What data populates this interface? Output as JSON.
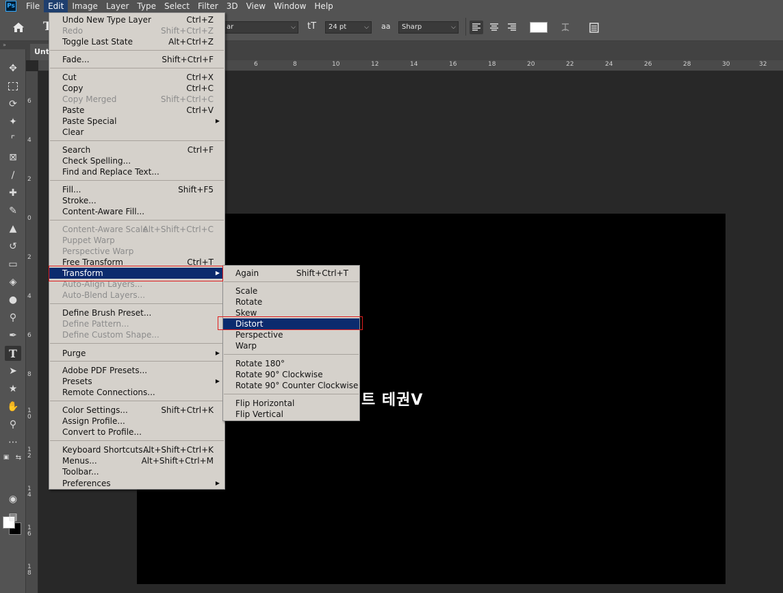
{
  "app": {
    "logo": "Ps"
  },
  "menubar": [
    "File",
    "Edit",
    "Image",
    "Layer",
    "Type",
    "Select",
    "Filter",
    "3D",
    "View",
    "Window",
    "Help"
  ],
  "options": {
    "type_tool_glyph": "T",
    "font_style": "ar",
    "size_icon": "tT",
    "font_size": "24 pt",
    "aa_icon": "aa",
    "antialias": "Sharp"
  },
  "document": {
    "tab_title": "Unti",
    "canvas_text": "트 테권V",
    "ruler_top_ticks": [
      "6",
      "8",
      "10",
      "12",
      "14",
      "16",
      "18",
      "20",
      "22",
      "24",
      "26",
      "28",
      "30",
      "32"
    ],
    "ruler_left_ticks": [
      "6",
      "4",
      "2",
      "0",
      "2",
      "4",
      "6",
      "8",
      "1 0",
      "1 2",
      "1 4",
      "1 6",
      "1 8"
    ]
  },
  "edit_menu": {
    "items": [
      {
        "label": "Undo New Type Layer",
        "shortcut": "Ctrl+Z"
      },
      {
        "label": "Redo",
        "shortcut": "Shift+Ctrl+Z",
        "disabled": true
      },
      {
        "label": "Toggle Last State",
        "shortcut": "Alt+Ctrl+Z"
      },
      {
        "label": "Fade...",
        "shortcut": "Shift+Ctrl+F"
      },
      {
        "label": "Cut",
        "shortcut": "Ctrl+X"
      },
      {
        "label": "Copy",
        "shortcut": "Ctrl+C"
      },
      {
        "label": "Copy Merged",
        "shortcut": "Shift+Ctrl+C",
        "disabled": true
      },
      {
        "label": "Paste",
        "shortcut": "Ctrl+V"
      },
      {
        "label": "Paste Special",
        "submenu": true
      },
      {
        "label": "Clear"
      },
      {
        "label": "Search",
        "shortcut": "Ctrl+F"
      },
      {
        "label": "Check Spelling..."
      },
      {
        "label": "Find and Replace Text..."
      },
      {
        "label": "Fill...",
        "shortcut": "Shift+F5"
      },
      {
        "label": "Stroke..."
      },
      {
        "label": "Content-Aware Fill..."
      },
      {
        "label": "Content-Aware Scale",
        "shortcut": "Alt+Shift+Ctrl+C",
        "disabled": true
      },
      {
        "label": "Puppet Warp",
        "disabled": true
      },
      {
        "label": "Perspective Warp",
        "disabled": true
      },
      {
        "label": "Free Transform",
        "shortcut": "Ctrl+T"
      },
      {
        "label": "Transform",
        "submenu": true,
        "highlighted": true
      },
      {
        "label": "Auto-Align Layers...",
        "disabled": true
      },
      {
        "label": "Auto-Blend Layers...",
        "disabled": true
      },
      {
        "label": "Define Brush Preset..."
      },
      {
        "label": "Define Pattern...",
        "disabled": true
      },
      {
        "label": "Define Custom Shape...",
        "disabled": true
      },
      {
        "label": "Purge",
        "submenu": true
      },
      {
        "label": "Adobe PDF Presets..."
      },
      {
        "label": "Presets",
        "submenu": true
      },
      {
        "label": "Remote Connections..."
      },
      {
        "label": "Color Settings...",
        "shortcut": "Shift+Ctrl+K"
      },
      {
        "label": "Assign Profile..."
      },
      {
        "label": "Convert to Profile..."
      },
      {
        "label": "Keyboard Shortcuts...",
        "shortcut": "Alt+Shift+Ctrl+K"
      },
      {
        "label": "Menus...",
        "shortcut": "Alt+Shift+Ctrl+M"
      },
      {
        "label": "Toolbar..."
      },
      {
        "label": "Preferences",
        "submenu": true
      }
    ]
  },
  "transform_menu": {
    "items": [
      {
        "label": "Again",
        "shortcut": "Shift+Ctrl+T"
      },
      {
        "label": "Scale"
      },
      {
        "label": "Rotate"
      },
      {
        "label": "Skew"
      },
      {
        "label": "Distort",
        "highlighted": true
      },
      {
        "label": "Perspective"
      },
      {
        "label": "Warp"
      },
      {
        "label": "Rotate 180°"
      },
      {
        "label": "Rotate 90° Clockwise"
      },
      {
        "label": "Rotate 90° Counter Clockwise"
      },
      {
        "label": "Flip Horizontal"
      },
      {
        "label": "Flip Vertical"
      }
    ]
  },
  "tools": [
    "move-icon",
    "marquee-icon",
    "lasso-icon",
    "magic-wand-icon",
    "crop-icon",
    "frame-icon",
    "eyedropper-icon",
    "healing-brush-icon",
    "brush-icon",
    "clone-stamp-icon",
    "history-brush-icon",
    "eraser-icon",
    "paint-bucket-icon",
    "blur-icon",
    "dodge-icon",
    "pen-icon",
    "type-icon",
    "path-selection-icon",
    "shape-icon",
    "hand-icon",
    "zoom-icon",
    "more-tools-icon"
  ],
  "colors": {
    "menu_bg": "#d5d1cb",
    "highlight": "#0b2b6e",
    "callout": "#e01e1e",
    "ui_panel": "#535353"
  }
}
